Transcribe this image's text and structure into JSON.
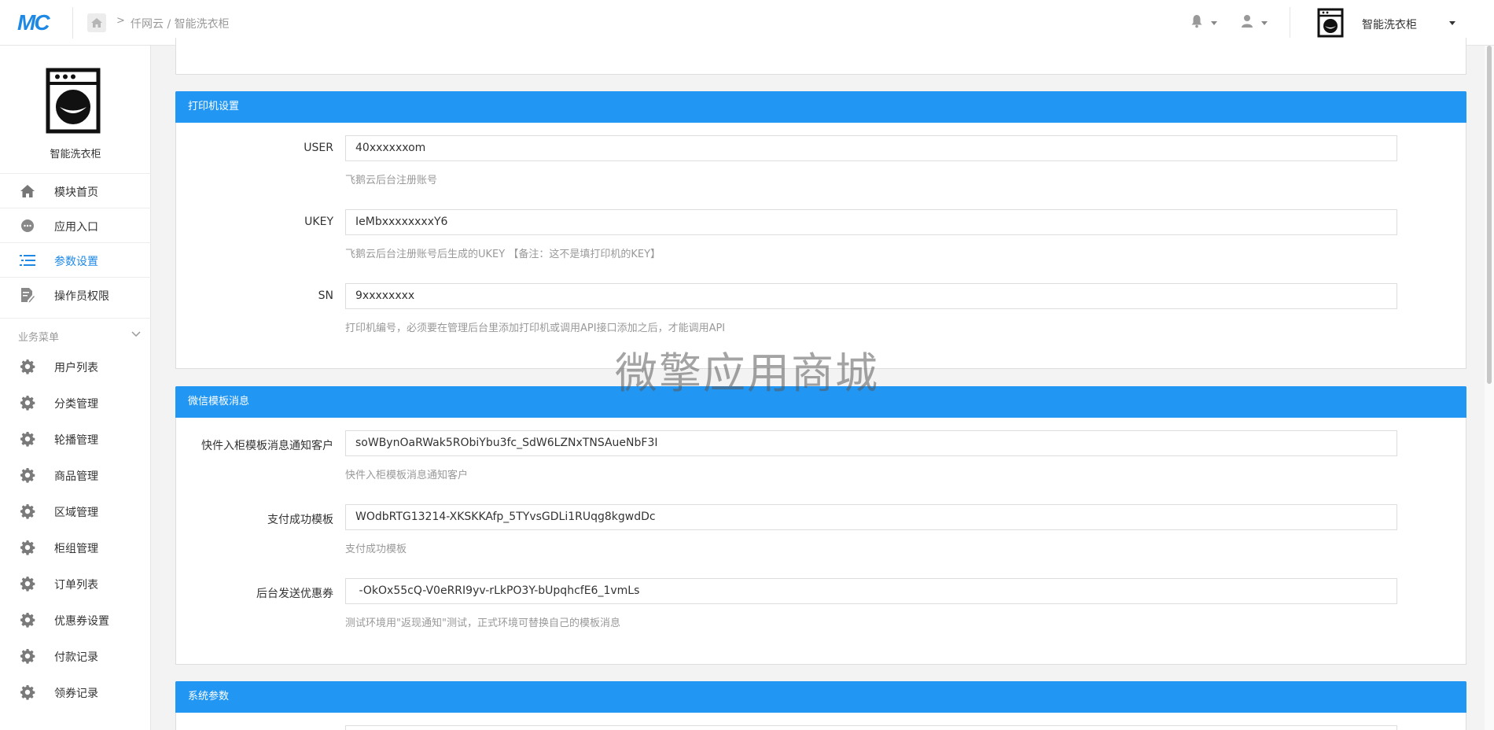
{
  "topbar": {
    "logo": "MC",
    "breadcrumb": "仟网云 / 智能洗衣柜",
    "app_name": "智能洗衣柜"
  },
  "sidebar": {
    "title": "智能洗衣柜",
    "items": [
      {
        "label": "模块首页",
        "icon": "home-icon"
      },
      {
        "label": "应用入口",
        "icon": "chat-icon"
      },
      {
        "label": "参数设置",
        "icon": "list-icon",
        "active": true
      },
      {
        "label": "操作员权限",
        "icon": "edit-icon"
      }
    ],
    "group_label": "业务菜单",
    "group_items": [
      {
        "label": "用户列表"
      },
      {
        "label": "分类管理"
      },
      {
        "label": "轮播管理"
      },
      {
        "label": "商品管理"
      },
      {
        "label": "区域管理"
      },
      {
        "label": "柜组管理"
      },
      {
        "label": "订单列表"
      },
      {
        "label": "优惠券设置"
      },
      {
        "label": "付款记录"
      },
      {
        "label": "领券记录"
      }
    ]
  },
  "printer": {
    "title": "打印机设置",
    "user_label": "USER",
    "user_value": "40xxxxxxom",
    "user_help": "飞鹅云后台注册账号",
    "ukey_label": "UKEY",
    "ukey_value": "IeMbxxxxxxxxY6",
    "ukey_help": "飞鹅云后台注册账号后生成的UKEY 【备注：这不是填打印机的KEY】",
    "sn_label": "SN",
    "sn_value": "9xxxxxxxx",
    "sn_help": "打印机编号，必须要在管理后台里添加打印机或调用API接口添加之后，才能调用API"
  },
  "wechat": {
    "title": "微信模板消息",
    "notify_label": "快件入柜模板消息通知客户",
    "notify_value": "soWBynOaRWak5RObiYbu3fc_SdW6LZNxTNSAueNbF3I",
    "notify_help": "快件入柜模板消息通知客户",
    "pay_label": "支付成功模板",
    "pay_value": "WOdbRTG13214-XKSKKAfp_5TYvsGDLi1RUqg8kgwdDc",
    "pay_help": "支付成功模板",
    "coupon_label": "后台发送优惠券",
    "coupon_value": " -OkOx55cQ-V0eRRI9yv-rLkPO3Y-bUpqhcfE6_1vmLs",
    "coupon_help": "测试环境用\"返现通知\"测试，正式环境可替换自己的模板消息"
  },
  "system": {
    "title": "系统参数"
  },
  "watermark": "微擎应用商城",
  "colors": {
    "accent": "#2196f3",
    "active": "#1e88e5"
  }
}
